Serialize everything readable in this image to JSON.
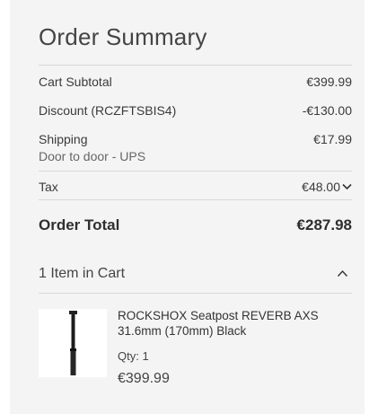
{
  "summary": {
    "title": "Order Summary",
    "subtotal_label": "Cart Subtotal",
    "subtotal_value": "€399.99",
    "discount_label": "Discount (RCZFTSBIS4)",
    "discount_value": "-€130.00",
    "shipping_label": "Shipping",
    "shipping_method": "Door to door - UPS",
    "shipping_value": "€17.99",
    "tax_label": "Tax",
    "tax_value": "€48.00",
    "total_label": "Order Total",
    "total_value": "€287.98"
  },
  "cart": {
    "items_label": "1 Item in Cart",
    "item": {
      "name": "ROCKSHOX Seatpost REVERB AXS 31.6mm (170mm) Black",
      "qty": "Qty: 1",
      "price": "€399.99"
    }
  },
  "icons": {
    "tax_toggle": "chevron-down-icon",
    "cart_toggle": "chevron-up-icon"
  }
}
